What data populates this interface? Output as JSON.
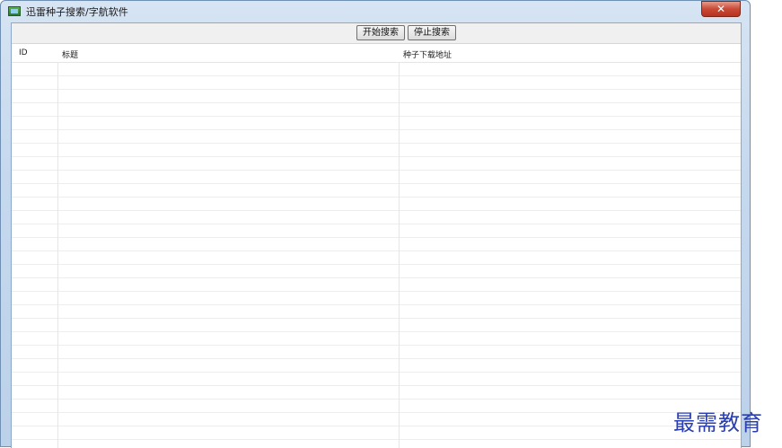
{
  "window": {
    "title": "迅雷种子搜索/字航软件",
    "close_label": "✕"
  },
  "toolbar": {
    "start_label": "开始搜索",
    "stop_label": "停止搜索"
  },
  "table": {
    "columns": [
      "ID",
      "标题",
      "种子下载地址"
    ],
    "rows": []
  },
  "watermark": "最需教育",
  "colors": {
    "title_gradient": "#c5d8ee",
    "close_button": "#c84a36",
    "watermark": "#2b3fb0"
  }
}
